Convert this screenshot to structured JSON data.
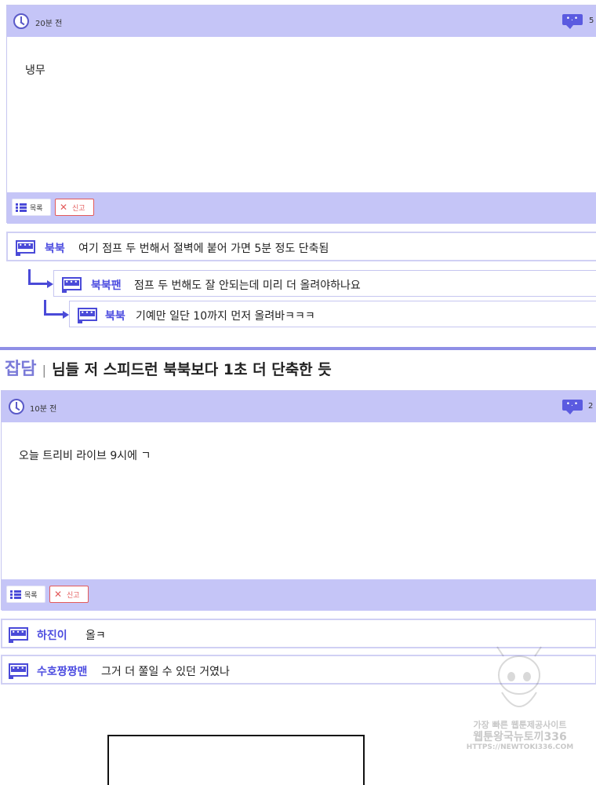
{
  "post1": {
    "time": "20분 전",
    "comment_count": "5",
    "body": "냉무",
    "list_label": "목록",
    "report_label": "신고"
  },
  "comments1": [
    {
      "author": "북북",
      "text": "여기 점프 두 번해서 절벽에 붙어 가면 5분 정도 단축됨"
    },
    {
      "author": "북북팬",
      "text": "점프 두 번해도 잘 안되는데 미리 더 올려야하나요"
    },
    {
      "author": "북북",
      "text": "기예만 일단 10까지 먼저 올려바ㅋㅋㅋ"
    }
  ],
  "post2_header": {
    "category": "잡담",
    "separator": "|",
    "title": "님들 저 스피드런 북북보다 1초 더 단축한 듯"
  },
  "post2": {
    "time": "10분 전",
    "comment_count": "2",
    "body": "오늘 트리비 라이브 9시에 ㄱ",
    "list_label": "목록",
    "report_label": "신고"
  },
  "comments2": [
    {
      "author": "하진이",
      "text": "올ㅋ"
    },
    {
      "author": "수호짱짱맨",
      "text": "그거 더 쭐일 수 있던 거였나"
    }
  ],
  "bubble_glyph": "•.•",
  "comment_icon_glyph": "•••",
  "watermark": {
    "line1": "가장 빠른 웹툰제공사이트",
    "line2": "웹툰왕국뉴토끼336",
    "line3": "HTTPS://NEWTOKI336.COM"
  },
  "colors": {
    "accent": "#4d4de0",
    "bar": "#c5c5f7",
    "report": "#e35a5a"
  }
}
